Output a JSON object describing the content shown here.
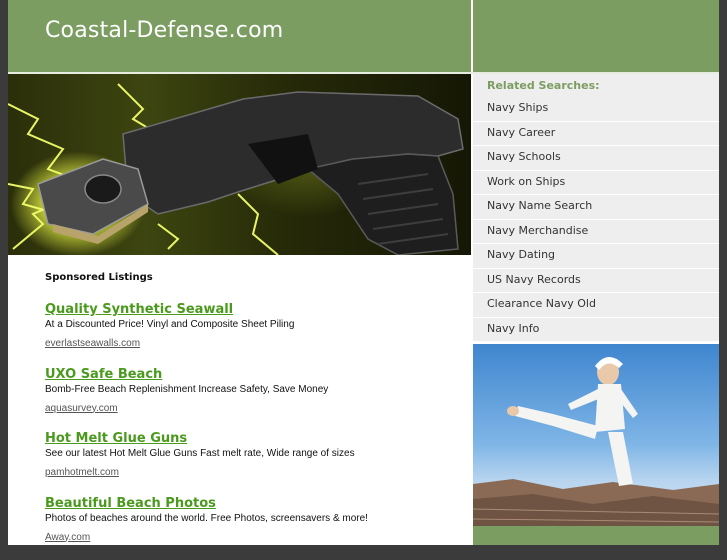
{
  "header": {
    "site_title": "Coastal-Defense.com"
  },
  "hero": {
    "image_name": "taser-with-lightning-image"
  },
  "sponsored": {
    "heading": "Sponsored Listings",
    "listings": [
      {
        "title": "Quality Synthetic Seawall",
        "description": "At a Discounted Price! Vinyl and Composite Sheet Piling",
        "url": "everlastseawalls.com"
      },
      {
        "title": "UXO Safe Beach",
        "description": "Bomb-Free Beach Replenishment Increase Safety, Save Money",
        "url": "aquasurvey.com"
      },
      {
        "title": "Hot Melt Glue Guns",
        "description": "See our latest Hot Melt Glue Guns Fast melt rate, Wide range of sizes",
        "url": "pamhotmelt.com"
      },
      {
        "title": "Beautiful Beach Photos",
        "description": "Photos of beaches around the world. Free Photos, screensavers & more!",
        "url": "Away.com"
      }
    ]
  },
  "sidebar": {
    "heading": "Related Searches:",
    "items": [
      "Navy Ships",
      "Navy Career",
      "Navy Schools",
      "Work on Ships",
      "Navy Name Search",
      "Navy Merchandise",
      "Navy Dating",
      "US Navy Records",
      "Clearance Navy Old",
      "Navy Info"
    ]
  },
  "side_photo": {
    "image_name": "woman-kickboxing-photo"
  },
  "colors": {
    "accent_green": "#7c9d62",
    "link_green": "#4a9a1d",
    "outer_bg": "#3b3b3b"
  }
}
